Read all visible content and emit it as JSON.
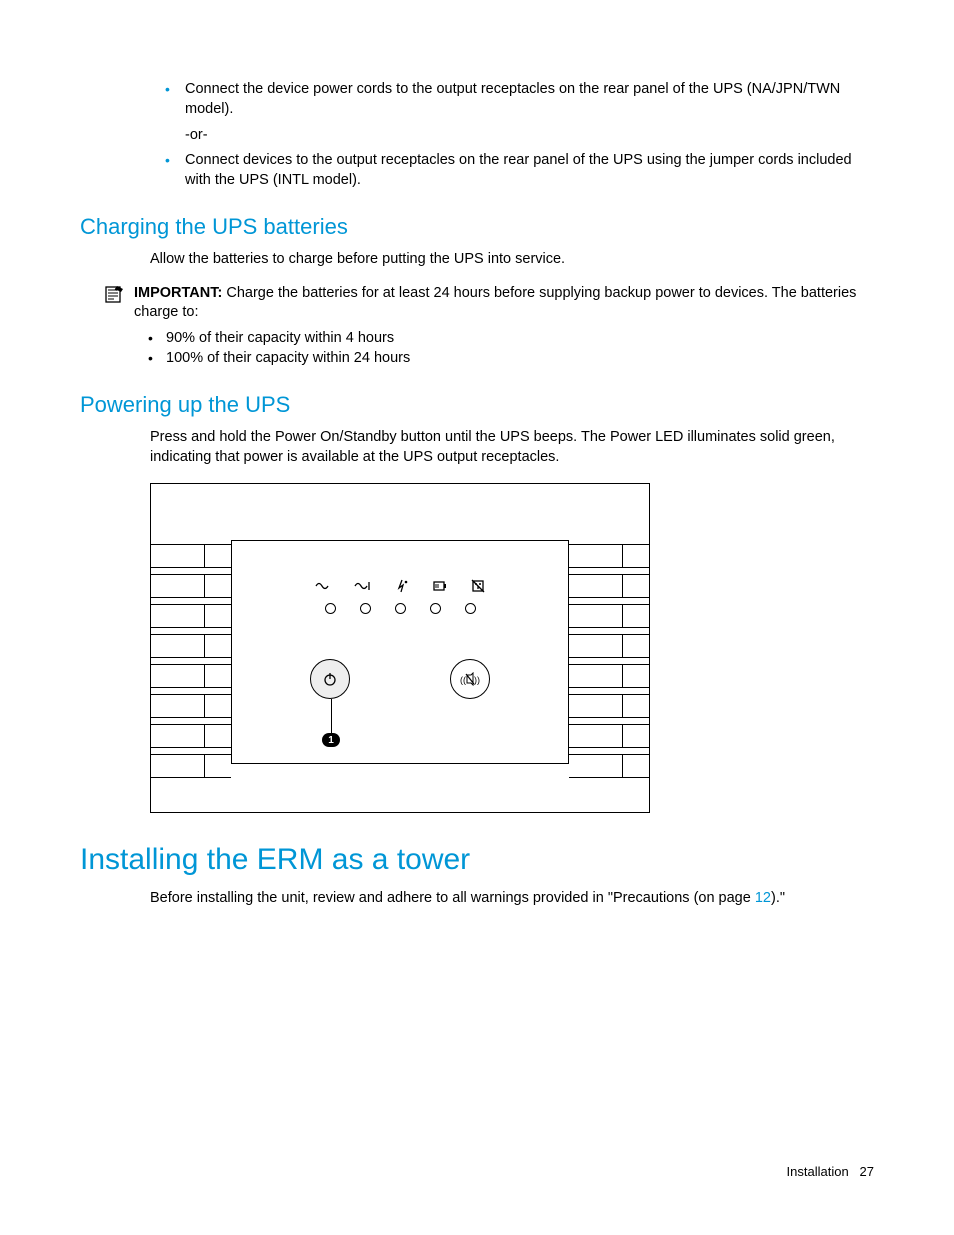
{
  "bullets": [
    "Connect the device power cords to the output receptacles on the rear panel of the UPS (NA/JPN/TWN model).",
    "Connect devices to the output receptacles on the rear panel of the UPS using the jumper cords included with the UPS (INTL model)."
  ],
  "or_text": "-or-",
  "section_charging": {
    "title": "Charging the UPS batteries",
    "body": "Allow the batteries to charge before putting the UPS into service.",
    "important_label": "IMPORTANT:",
    "important_text": "  Charge the batteries for at least 24 hours before supplying backup power to devices. The batteries charge to:",
    "sub_bullets": [
      "90% of their capacity within 4 hours",
      "100% of their capacity within 24 hours"
    ]
  },
  "section_powering": {
    "title": "Powering up the UPS",
    "body": "Press and hold the Power On/Standby button until the UPS beeps. The Power LED illuminates solid green, indicating that power is available at the UPS output receptacles."
  },
  "figure": {
    "callout": "1"
  },
  "section_installing": {
    "title": "Installing the ERM as a tower",
    "body_pre": "Before installing the unit, review and adhere to all warnings provided in \"Precautions (on page ",
    "link": "12",
    "body_post": ").\""
  },
  "footer": {
    "section": "Installation",
    "page": "27"
  }
}
